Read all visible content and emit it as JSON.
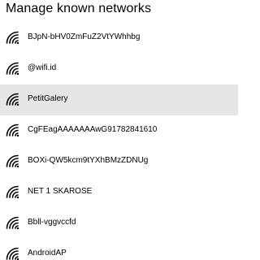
{
  "header": {
    "title": "Manage known networks"
  },
  "networks": [
    {
      "name": "BJpN-bHV0ZmFuZ2VtYWhhbg",
      "icon": "wifi-signal-icon",
      "selected": false
    },
    {
      "name": "@wifi.id",
      "icon": "wifi-signal-icon",
      "selected": false
    },
    {
      "name": "PetitGalery",
      "icon": "wifi-signal-icon",
      "selected": true
    },
    {
      "name": "CgFEagAAAAAAAwG91782841610",
      "icon": "wifi-signal-icon",
      "selected": false
    },
    {
      "name": "BOXi-QW5kcm9tYXhBMzZDNUg",
      "icon": "wifi-signal-icon",
      "selected": false
    },
    {
      "name": "NET 1 SKAROSE",
      "icon": "wifi-signal-icon",
      "selected": false
    },
    {
      "name": "Bbll-vggvccfd",
      "icon": "wifi-signal-icon",
      "selected": false
    },
    {
      "name": "AndroidAP",
      "icon": "wifi-signal-icon",
      "selected": false
    }
  ],
  "colors": {
    "selected_background": "#e6e6e6",
    "text": "#000000",
    "background": "#ffffff"
  }
}
